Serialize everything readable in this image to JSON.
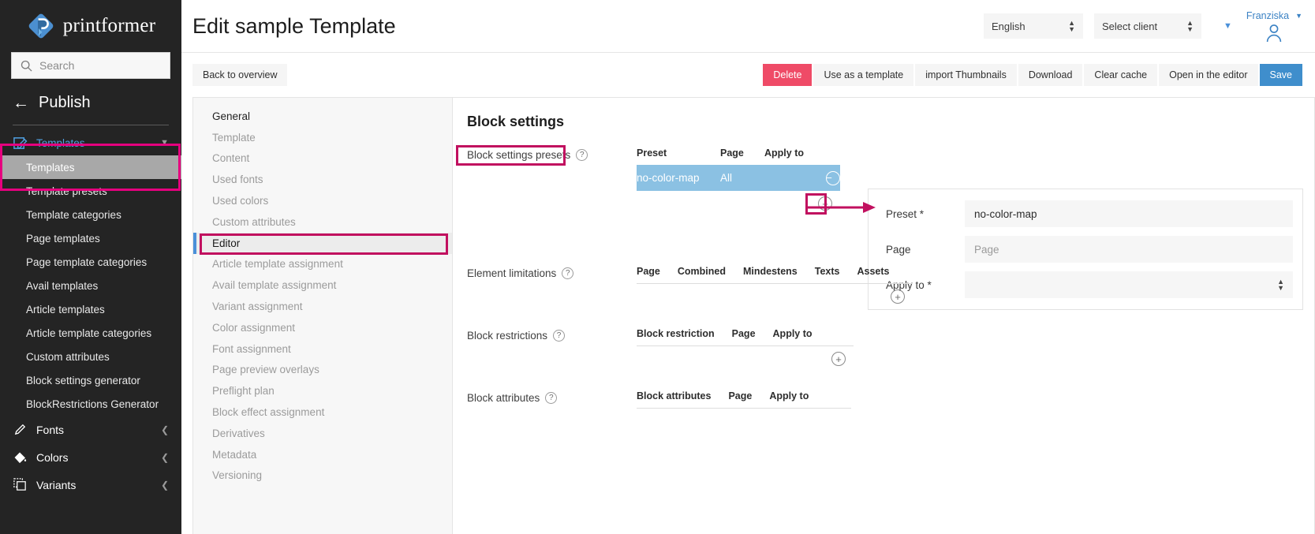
{
  "brand": {
    "name": "printformer",
    "logo_icon": "printformer-logo-icon",
    "accent_blue": "#4a90d9",
    "accent_pink": "#e6007e"
  },
  "sidebar": {
    "search": {
      "placeholder": "Search",
      "icon": "search-icon"
    },
    "publish": {
      "label": "Publish",
      "icon": "arrow-left-icon"
    },
    "group": {
      "label": "Templates",
      "icon": "edit-pencil-square-icon",
      "chevron": "chevron-down-icon"
    },
    "sub_items": [
      {
        "label": "Templates",
        "active": true
      },
      {
        "label": "Template presets",
        "active": false
      },
      {
        "label": "Template categories",
        "active": false
      },
      {
        "label": "Page templates",
        "active": false
      },
      {
        "label": "Page template categories",
        "active": false
      },
      {
        "label": "Avail templates",
        "active": false
      },
      {
        "label": "Article templates",
        "active": false
      },
      {
        "label": "Article template categories",
        "active": false
      },
      {
        "label": "Custom attributes",
        "active": false
      },
      {
        "label": "Block settings generator",
        "active": false
      },
      {
        "label": "BlockRestrictions Generator",
        "active": false
      }
    ],
    "bottom_items": [
      {
        "label": "Fonts",
        "icon": "pencil-icon",
        "chevron": "chevron-right-icon"
      },
      {
        "label": "Colors",
        "icon": "paint-bucket-icon",
        "chevron": "chevron-right-icon"
      },
      {
        "label": "Variants",
        "icon": "copy-frame-icon",
        "chevron": "chevron-right-icon"
      }
    ]
  },
  "header": {
    "title": "Edit sample Template",
    "language_select": {
      "value": "English",
      "icon": "select-arrows-icon"
    },
    "client_select": {
      "value": "Select client",
      "icon": "select-arrows-icon"
    },
    "extra_caret": "caret-down-icon",
    "user": {
      "name": "Franziska",
      "caret": "caret-down-icon",
      "avatar": "user-avatar-icon"
    }
  },
  "toolbar": {
    "back": "Back to overview",
    "delete": "Delete",
    "use_as_template": "Use as a template",
    "import_thumbnails": "import Thumbnails",
    "download": "Download",
    "clear_cache": "Clear cache",
    "open_in_editor": "Open in the editor",
    "save": "Save"
  },
  "subnav": {
    "items": [
      {
        "label": "General",
        "state": "first"
      },
      {
        "label": "Template",
        "state": "normal"
      },
      {
        "label": "Content",
        "state": "normal"
      },
      {
        "label": "Used fonts",
        "state": "normal"
      },
      {
        "label": "Used colors",
        "state": "normal"
      },
      {
        "label": "Custom attributes",
        "state": "normal"
      },
      {
        "label": "Editor",
        "state": "selected"
      },
      {
        "label": "Article template assignment",
        "state": "normal"
      },
      {
        "label": "Avail template assignment",
        "state": "normal"
      },
      {
        "label": "Variant assignment",
        "state": "normal"
      },
      {
        "label": "Color assignment",
        "state": "normal"
      },
      {
        "label": "Font assignment",
        "state": "normal"
      },
      {
        "label": "Page preview overlays",
        "state": "normal"
      },
      {
        "label": "Preflight plan",
        "state": "normal"
      },
      {
        "label": "Block effect assignment",
        "state": "normal"
      },
      {
        "label": "Derivatives",
        "state": "normal"
      },
      {
        "label": "Metadata",
        "state": "normal"
      },
      {
        "label": "Versioning",
        "state": "normal"
      }
    ]
  },
  "panel": {
    "title": "Block settings",
    "presets": {
      "label": "Block settings presets",
      "help": "?",
      "columns": [
        "Preset",
        "Page",
        "Apply to"
      ],
      "rows": [
        {
          "preset": "no-color-map",
          "page": "All",
          "remove_icon": "minus-circle-icon",
          "selected": true
        }
      ],
      "add_icon": "plus-circle-icon"
    },
    "element_limitations": {
      "label": "Element limitations",
      "help": "?",
      "columns": [
        "Page",
        "Combined",
        "Mindestens",
        "Texts",
        "Assets"
      ],
      "rows": [],
      "add_icon": "plus-circle-icon"
    },
    "block_restrictions": {
      "label": "Block restrictions",
      "help": "?",
      "columns": [
        "Block restriction",
        "Page",
        "Apply to"
      ],
      "rows": [],
      "add_icon": "plus-circle-icon"
    },
    "block_attributes": {
      "label": "Block attributes",
      "help": "?",
      "columns": [
        "Block attributes",
        "Page",
        "Apply to"
      ],
      "rows": []
    },
    "detail": {
      "preset": {
        "label": "Preset *",
        "value": "no-color-map"
      },
      "page": {
        "label": "Page",
        "value": "",
        "placeholder": "Page"
      },
      "apply_to": {
        "label": "Apply to *",
        "value": "",
        "icon": "select-arrows-icon"
      }
    }
  }
}
